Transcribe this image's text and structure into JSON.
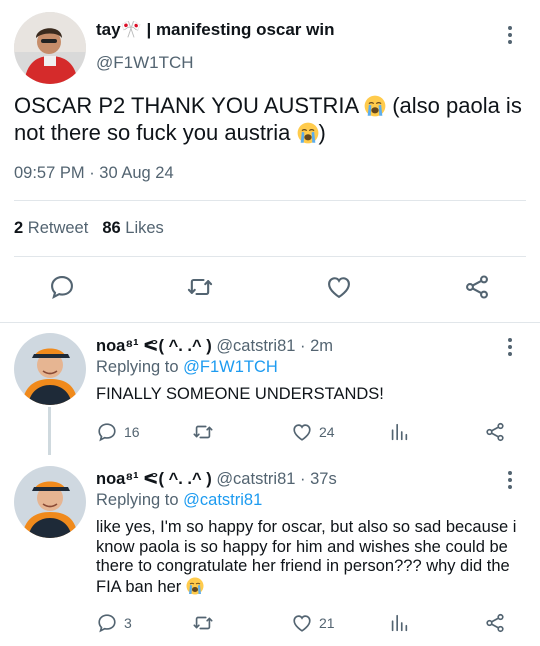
{
  "main_tweet": {
    "display_name": "tay🎌 | manifesting oscar win",
    "handle": "@F1W1TCH",
    "text_part1": "OSCAR P2 THANK YOU AUSTRIA ",
    "text_part2": " (also paola is not there so fuck you austria ",
    "text_part3": ")",
    "time": "09:57 PM",
    "date": "30 Aug 24",
    "retweet_count": "2",
    "retweet_label": "Retweet",
    "like_count": "86",
    "like_label": "Likes"
  },
  "replies": [
    {
      "display_name": "noa⁸¹ ᕕ( ᐛ )ᕗ",
      "name_shown": "noa⁸¹ ᕙ( ^. .^ )",
      "handle": "@catstri81",
      "time_ago": "2m",
      "replying_label": "Replying to ",
      "replying_to": "@F1W1TCH",
      "text": "FINALLY SOMEONE UNDERSTANDS!",
      "reply_count": "16",
      "like_count": "24"
    },
    {
      "display_name": "noa⁸¹ ᕕ( ᐛ )ᕗ",
      "name_shown": "noa⁸¹ ᕙ( ^. .^ )",
      "handle": "@catstri81",
      "time_ago": "37s",
      "replying_label": "Replying to ",
      "replying_to": "@catstri81",
      "text": "like yes, I'm so happy for oscar, but also so sad because i know paola is so happy for him and wishes she could be there to congratulate her friend in person??? why did the FIA ban her ",
      "reply_count": "3",
      "like_count": "21"
    }
  ],
  "icons": {
    "reply": "speech-bubble-icon",
    "retweet": "retweet-icon",
    "like": "heart-icon",
    "share": "share-icon",
    "analytics": "bar-chart-icon",
    "menu": "vertical-dots-icon"
  },
  "colors": {
    "text": "#0f1419",
    "secondary": "#536471",
    "link": "#1d9bf0",
    "divider": "#e1e6ea"
  }
}
